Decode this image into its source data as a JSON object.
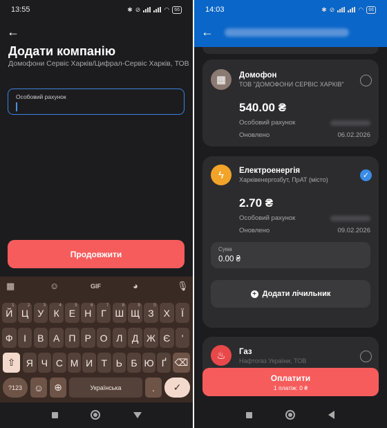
{
  "left": {
    "status": {
      "time": "13:55",
      "battery": "66"
    },
    "title": "Додати компанію",
    "subtitle": "Домофони Сервіс Харків/Цифрал-Сервіс Харків, ТОВ",
    "account_field": {
      "label": "Особовий рахунок",
      "value": ""
    },
    "continue_label": "Продовжити",
    "keyboard": {
      "toolbar_gif": "GIF",
      "row1": [
        [
          "Й",
          "1"
        ],
        [
          "Ц",
          "2"
        ],
        [
          "У",
          "3"
        ],
        [
          "К",
          "4"
        ],
        [
          "Е",
          "5"
        ],
        [
          "Н",
          "6"
        ],
        [
          "Г",
          "7"
        ],
        [
          "Ш",
          "8"
        ],
        [
          "Щ",
          "9"
        ],
        [
          "З",
          "0"
        ],
        [
          "Х",
          ""
        ],
        [
          "Ї",
          ""
        ]
      ],
      "row2": [
        "Ф",
        "І",
        "В",
        "А",
        "П",
        "Р",
        "О",
        "Л",
        "Д",
        "Ж",
        "Є",
        "'"
      ],
      "row3": [
        "Я",
        "Ч",
        "С",
        "М",
        "И",
        "Т",
        "Ь",
        "Б",
        "Ю",
        "Ґ"
      ],
      "sym_label": "?123",
      "emoji_label": "☺",
      "comma_label": ",",
      "space_label": "Українська",
      "period_label": ".",
      "enter_label": "✓"
    }
  },
  "right": {
    "status": {
      "time": "14:03",
      "battery": "66"
    },
    "cards": [
      {
        "name": "Домофон",
        "provider": "ТОВ \"ДОМОФОНИ СЕРВІС ХАРКІВ\"",
        "amount": "540.00 ₴",
        "account_label": "Особовий рахунок",
        "updated_label": "Оновлено",
        "updated_value": "06.02.2026",
        "icon": "intercom-icon",
        "icon_color": "#8b7a72",
        "selected": false
      },
      {
        "name": "Електроенергія",
        "provider": "Харківенергозбут, ПрАТ (місто)",
        "amount": "2.70 ₴",
        "account_label": "Особовий рахунок",
        "updated_label": "Оновлено",
        "updated_value": "09.02.2026",
        "icon": "lightning-icon",
        "icon_color": "#f2a42a",
        "selected": true
      },
      {
        "name": "Газ",
        "provider": "Нафтогаз України, ТОВ",
        "icon": "flame-icon",
        "icon_color": "#e8484a",
        "selected": false
      }
    ],
    "sum": {
      "label": "Сума",
      "value": "0.00 ₴"
    },
    "add_meter_label": "Додати лічильник",
    "pay": {
      "label": "Оплатити",
      "sub": "1 платіж: 0 ₴"
    }
  },
  "colors": {
    "accent_red": "#f65c5c",
    "blue_header": "#0a66c8",
    "check_blue": "#3a8ce6"
  }
}
